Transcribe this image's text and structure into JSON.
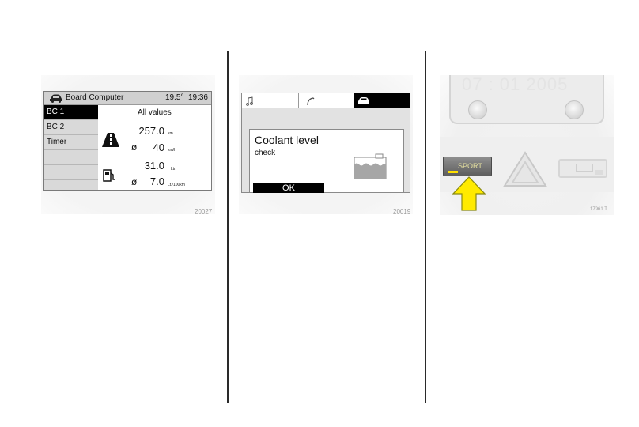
{
  "figures": [
    {
      "caption": "20027",
      "board_computer": {
        "title": "Board Computer",
        "temperature": "19.5°",
        "clock": "19:36",
        "menu": [
          "BC 1",
          "BC 2",
          "Timer"
        ],
        "active_menu": "BC 1",
        "main_title": "All values",
        "rows": [
          {
            "symbol": "",
            "value": "257.0",
            "unit": "km"
          },
          {
            "symbol": "ø",
            "value": "40",
            "unit": "km/h"
          },
          {
            "symbol": "",
            "value": "31.0",
            "unit": "Ltr."
          },
          {
            "symbol": "ø",
            "value": "7.0",
            "unit": "Lt./100km"
          }
        ],
        "icons": [
          "car-icon",
          "road-icon",
          "fuel-pump-icon"
        ]
      }
    },
    {
      "caption": "20019",
      "coolant_display": {
        "tab_icons": [
          "music-note-icon",
          "phone-icon",
          "car-icon"
        ],
        "active_tab": 2,
        "message_title": "Coolant level",
        "message_subtitle": "check",
        "ok_label": "OK",
        "icon": "coolant-reservoir-icon"
      }
    },
    {
      "caption": "17961 T",
      "dashboard": {
        "button_label": "SPORT",
        "clock_display": "07 : 01 2005",
        "accent_color": "#ffea00",
        "icons": [
          "hazard-triangle-icon",
          "arrow-up-icon"
        ]
      }
    }
  ]
}
